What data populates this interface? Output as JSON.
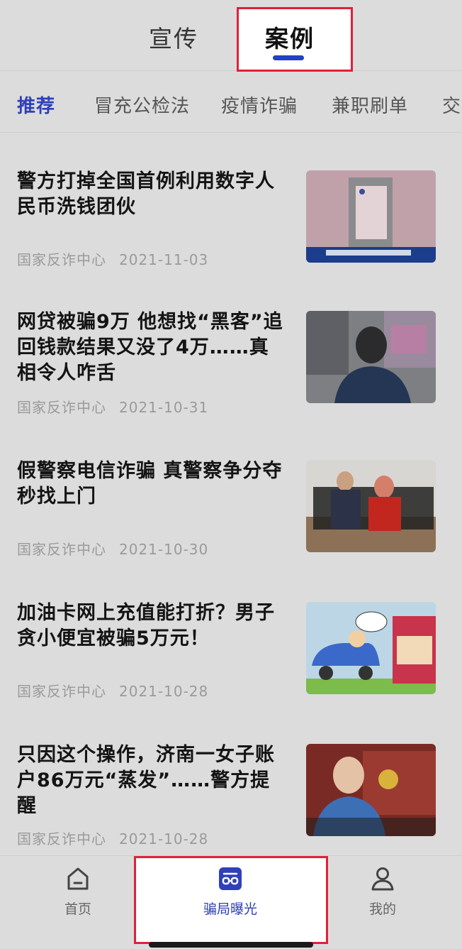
{
  "top_tabs": {
    "propaganda": "宣传",
    "cases": "案例"
  },
  "categories": [
    "推荐",
    "冒充公检法",
    "疫情诈骗",
    "兼职刷单",
    "交"
  ],
  "news": [
    {
      "title": "警方打掉全国首例利用数字人民币洗钱团伙",
      "source": "国家反诈中心",
      "date": "2021-11-03"
    },
    {
      "title": "网贷被骗9万 他想找“黑客”追回钱款结果又没了4万……真相令人咋舌",
      "source": "国家反诈中心",
      "date": "2021-10-31"
    },
    {
      "title": "假警察电信诈骗 真警察争分夺秒找上门",
      "source": "国家反诈中心",
      "date": "2021-10-30"
    },
    {
      "title": "加油卡网上充值能打折？男子贪小便宜被骗5万元！",
      "source": "国家反诈中心",
      "date": "2021-10-28"
    },
    {
      "title": "只因这个操作，济南一女子账户86万元“蒸发”……警方提醒",
      "source": "国家反诈中心",
      "date": "2021-10-28"
    }
  ],
  "nav": {
    "home": "首页",
    "scam_exposure": "骗局曝光",
    "mine": "我的"
  },
  "colors": {
    "accent": "#2f40b8",
    "highlight": "#e0203a"
  }
}
